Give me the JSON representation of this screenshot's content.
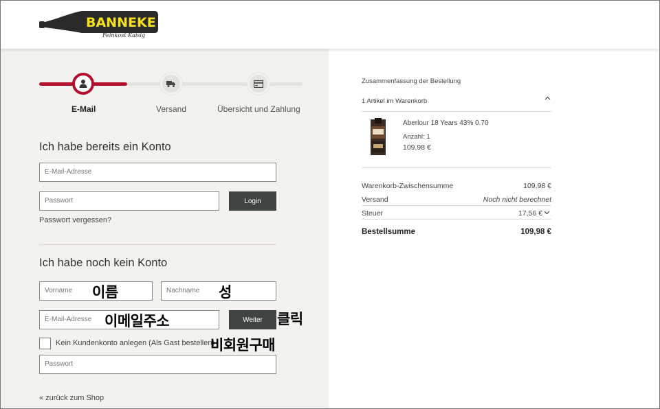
{
  "brand": {
    "name": "BANNEKE",
    "tagline": "Feinkost Kaisig",
    "bottle_color": "#2a2a2a",
    "label_color": "#f5e21c"
  },
  "steps": [
    {
      "label": "E-Mail",
      "icon": "user-icon",
      "active": true
    },
    {
      "label": "Versand",
      "icon": "truck-icon",
      "active": false
    },
    {
      "label": "Übersicht und Zahlung",
      "icon": "credit-card-icon",
      "active": false
    }
  ],
  "login": {
    "heading": "Ich habe bereits ein Konto",
    "email_placeholder": "E-Mail-Adresse",
    "password_placeholder": "Passwort",
    "login_button": "Login",
    "forgot_link": "Passwort vergessen?"
  },
  "register": {
    "heading": "Ich habe noch kein Konto",
    "firstname_placeholder": "Vorname",
    "lastname_placeholder": "Nachname",
    "email_placeholder": "E-Mail-Adresse",
    "continue_button": "Weiter",
    "guest_checkbox_label": "Kein Kundenkonto anlegen (Als Gast bestellen)",
    "password_placeholder": "Passwort"
  },
  "annotations": {
    "firstname": "이름",
    "lastname": "성",
    "email": "이메일주소",
    "click": "클릭",
    "guest": "비회원구매"
  },
  "back_link": "« zurück zum Shop",
  "summary": {
    "title": "Zusammenfassung der Bestellung",
    "cart_count": "1 Artikel im Warenkorb",
    "product": {
      "name": "Aberlour 18 Years 43% 0.70",
      "quantity": "Anzahl: 1",
      "price": "109,98 €"
    },
    "rows": [
      {
        "label": "Warenkorb-Zwischensumme",
        "value": "109,98 €"
      },
      {
        "label": "Versand",
        "value": "Noch nicht berechnet"
      },
      {
        "label": "Steuer",
        "value": "17,56 €"
      }
    ],
    "total_label": "Bestellsumme",
    "total_value": "109,98 €"
  },
  "colors": {
    "accent": "#b50e2e",
    "button": "#3d4442",
    "left_background": "#f4f2ef"
  }
}
